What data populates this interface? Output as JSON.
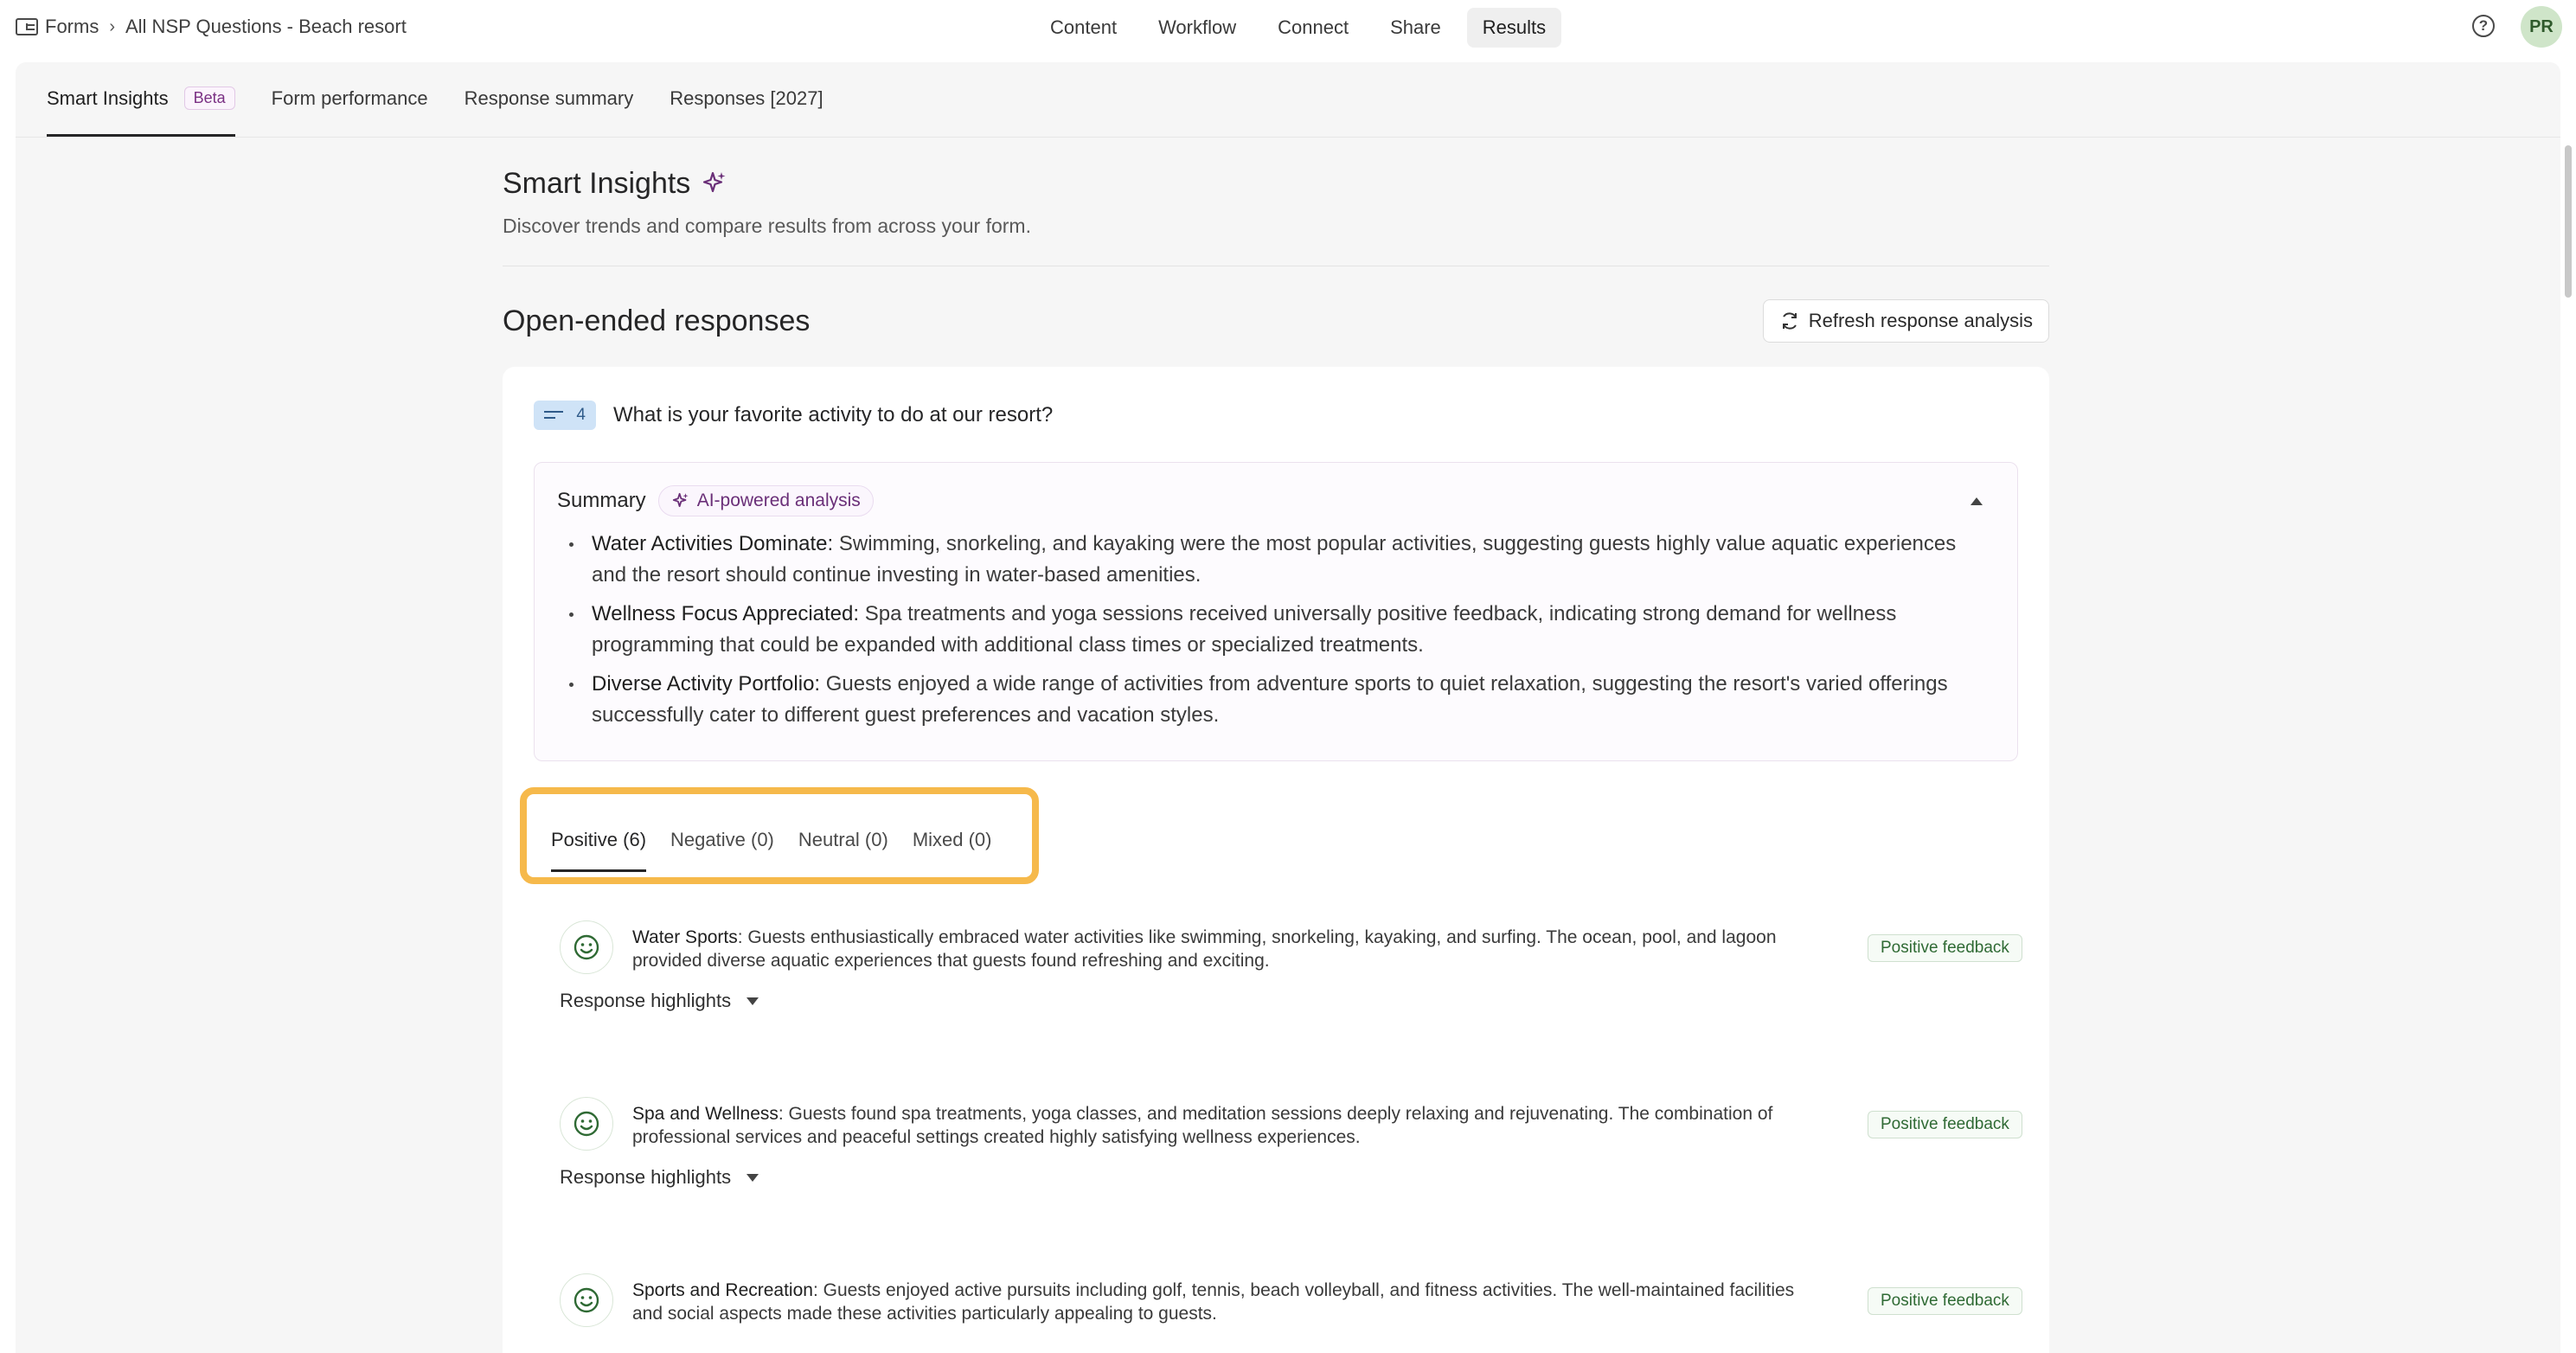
{
  "breadcrumb": {
    "root": "Forms",
    "current": "All NSP Questions - Beach resort"
  },
  "nav": [
    "Content",
    "Workflow",
    "Connect",
    "Share",
    "Results"
  ],
  "nav_active": "Results",
  "user": {
    "initials": "PR"
  },
  "subtabs": {
    "smart": "Smart Insights",
    "beta": "Beta",
    "performance": "Form performance",
    "summary": "Response summary",
    "responses": "Responses [2027]"
  },
  "page": {
    "title": "Smart Insights",
    "subtitle": "Discover trends and compare results from across your form."
  },
  "section": {
    "title": "Open-ended responses",
    "refresh_label": "Refresh response analysis"
  },
  "question": {
    "number": "4",
    "text": "What is your favorite activity to do at our resort?"
  },
  "summary": {
    "title": "Summary",
    "ai_label": "AI-powered analysis",
    "bullets": [
      {
        "head": "Water Activities Dominate:",
        "text": " Swimming, snorkeling, and kayaking were the most popular activities, suggesting guests highly value aquatic experiences and the resort should continue investing in water-based amenities."
      },
      {
        "head": "Wellness Focus Appreciated:",
        "text": " Spa treatments and yoga sessions received universally positive feedback, indicating strong demand for wellness programming that could be expanded with additional class times or specialized treatments."
      },
      {
        "head": "Diverse Activity Portfolio:",
        "text": " Guests enjoyed a wide range of activities from adventure sports to quiet relaxation, suggesting the resort's varied offerings successfully cater to different guest preferences and vacation styles."
      }
    ]
  },
  "sentiment_tabs": [
    "Positive (6)",
    "Negative (0)",
    "Neutral (0)",
    "Mixed (0)"
  ],
  "insights": [
    {
      "head": "Water Sports",
      "text": ": Guests enthusiastically embraced water activities like swimming, snorkeling, kayaking, and surfing. The ocean, pool, and lagoon provided diverse aquatic experiences that guests found refreshing and exciting.",
      "badge": "Positive feedback",
      "highlights": "Response highlights"
    },
    {
      "head": "Spa and Wellness",
      "text": ": Guests found spa treatments, yoga classes, and meditation sessions deeply relaxing and rejuvenating. The combination of professional services and peaceful settings created highly satisfying wellness experiences.",
      "badge": "Positive feedback",
      "highlights": "Response highlights"
    },
    {
      "head": "Sports and Recreation",
      "text": ": Guests enjoyed active pursuits including golf, tennis, beach volleyball, and fitness activities. The well-maintained facilities and social aspects made these activities particularly appealing to guests.",
      "badge": "Positive feedback",
      "highlights": "Response highlights"
    }
  ],
  "colors": {
    "highlight_outline": "#f6b94b",
    "ai_purple": "#6a2f78",
    "positive_green": "#2f6a34",
    "question_badge": "#cfe3f7"
  }
}
